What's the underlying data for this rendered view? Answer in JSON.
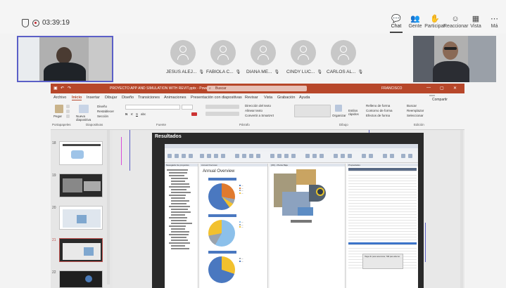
{
  "meeting": {
    "timer": "03:39:19",
    "toolbar": [
      {
        "label": "Chat",
        "icon": "chat-icon",
        "glyph": "💬"
      },
      {
        "label": "Gente",
        "icon": "people-icon",
        "glyph": "👥"
      },
      {
        "label": "Participar",
        "icon": "raise-hand-icon",
        "glyph": "✋"
      },
      {
        "label": "Reaccionar",
        "icon": "react-icon",
        "glyph": "☺"
      },
      {
        "label": "Vista",
        "icon": "view-icon",
        "glyph": "▦"
      },
      {
        "label": "Má",
        "icon": "more-icon",
        "glyph": "⋯"
      }
    ],
    "participants": [
      {
        "name": "JESUS ALEJ..."
      },
      {
        "name": "FABIOLA C..."
      },
      {
        "name": "DIANA ME..."
      },
      {
        "name": "CINDY LUC..."
      },
      {
        "name": "CARLOS AL..."
      }
    ]
  },
  "ppt": {
    "title": "PROYECTO APP AND SIMULATION WITH REVIT.pptx - PowerPoint",
    "search_placeholder": "Buscar",
    "user": "FRANCISCO",
    "share_label": "Compartir",
    "menu": [
      "Archivo",
      "Inicio",
      "Insertar",
      "Dibujar",
      "Diseño",
      "Transiciones",
      "Animaciones",
      "Presentación con diapositivas",
      "Revisar",
      "Vista",
      "Grabación",
      "Ayuda"
    ],
    "active_menu": "Inicio",
    "ribbon": {
      "paste": "Pegar",
      "new_slide": "Nueva diapositiva",
      "layout": "Diseño",
      "reset": "Restablecer",
      "section": "Sección",
      "groups": [
        "Portapapeles",
        "Diapositivas",
        "Fuente",
        "Párrafo",
        "Dibujo",
        "Edición"
      ],
      "arrange": "Organizar",
      "quick_styles": "Estilos rápidos",
      "shape_fill": "Relleno de forma",
      "shape_outline": "Contorno de forma",
      "shape_effects": "Efectos de forma",
      "text_direction": "Dirección del texto",
      "align_text": "Alinear texto",
      "smartart": "Convertir a SmartArt",
      "find": "Buscar",
      "replace": "Reemplazar",
      "select": "Seleccionar"
    },
    "thumbnails": [
      {
        "num": "18"
      },
      {
        "num": "19"
      },
      {
        "num": "20"
      },
      {
        "num": "21"
      },
      {
        "num": "22"
      }
    ],
    "slide": {
      "title": "Resultados",
      "revit": {
        "chart_title": "Annual Overview",
        "browser_header": "Navegador de proyectos",
        "schedule_header": "Annual Overview",
        "plan_header": "{3D} - Planta Baja",
        "props_header": "Propiedades",
        "tooltip": "Haga clic para seleccionar, TAB para alternar."
      }
    }
  },
  "colors": {
    "ppt_accent": "#b7472a",
    "teams_accent": "#5b5fc7",
    "pie_blue": "#4a78c0",
    "pie_orange": "#e07a2e",
    "pie_yellow": "#f2c12e",
    "pie_gray": "#9aa3ad",
    "pie_light": "#8cc0ea"
  }
}
